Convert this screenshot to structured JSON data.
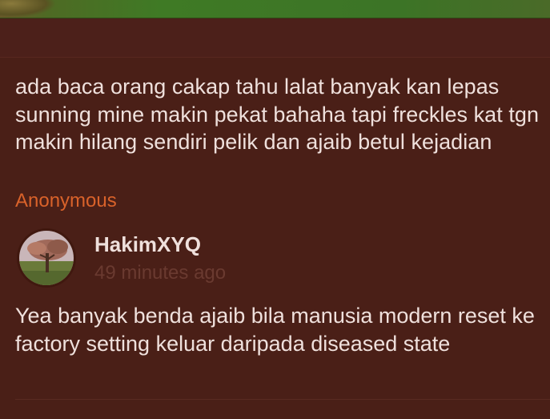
{
  "comment": {
    "text": "ada baca orang cakap tahu lalat banyak kan lepas sunning mine makin pekat bahaha tapi freckles kat tgn makin hilang sendiri pelik dan ajaib betul kejadian",
    "author": "Anonymous"
  },
  "reply": {
    "author": "HakimXYQ",
    "timestamp": "49 minutes ago",
    "text": "Yea banyak benda ajaib bila manusia modern reset ke factory setting keluar daripada diseased state",
    "avatar_icon": "tree-photo-avatar"
  },
  "colors": {
    "background": "#4a1f17",
    "text": "#efe0dc",
    "anonymous_accent": "#d9622a",
    "timestamp": "#6a3a30"
  }
}
